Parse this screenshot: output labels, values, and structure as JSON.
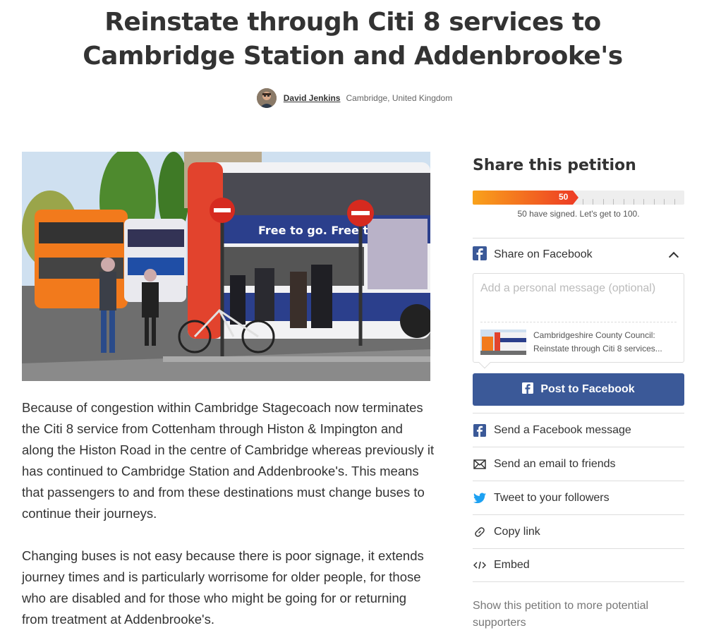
{
  "petition": {
    "title": "Reinstate through Citi 8 services to Cambridge Station and Addenbrooke's",
    "author_name": "David Jenkins",
    "author_location": "Cambridge, United Kingdom"
  },
  "story": {
    "paragraphs": [
      "Because of congestion within Cambridge Stagecoach now terminates the Citi 8 service from Cottenham through Histon & Impington and along the Histon Road in the centre of Cambridge whereas previously it has continued to Cambridge Station and Addenbrooke's. This means that passengers to and from these destinations must change buses to continue their journeys.",
      "Changing buses is not easy because there is poor signage, it extends journey times and is particularly worrisome for older people, for those who are disabled and for those who might be going for or returning from treatment at Addenbrooke's."
    ]
  },
  "photo": {
    "bus_ad_text": "Free to go. Free to sta"
  },
  "share": {
    "title": "Share this petition",
    "signatures": 50,
    "goal": 100,
    "progress_fraction": 0.5,
    "signature_count_label": "50",
    "progress_text": "50 have signed. Let's get to 100.",
    "facebook_label": "Share on Facebook",
    "message_placeholder": "Add a personal message (optional)",
    "preview_text": "Cambridgeshire County Council: Reinstate through Citi 8 services...",
    "post_button": "Post to Facebook",
    "items": [
      {
        "label": "Send a Facebook message",
        "icon": "facebook-icon"
      },
      {
        "label": "Send an email to friends",
        "icon": "email-icon"
      },
      {
        "label": "Tweet to your followers",
        "icon": "twitter-icon"
      },
      {
        "label": "Copy link",
        "icon": "link-icon"
      },
      {
        "label": "Embed",
        "icon": "code-icon"
      }
    ],
    "more_text": "Show this petition to more potential supporters"
  },
  "colors": {
    "facebook": "#3b5998",
    "progress_start": "#f9a21b",
    "progress_end": "#ee3f24",
    "twitter": "#1da1f2"
  }
}
